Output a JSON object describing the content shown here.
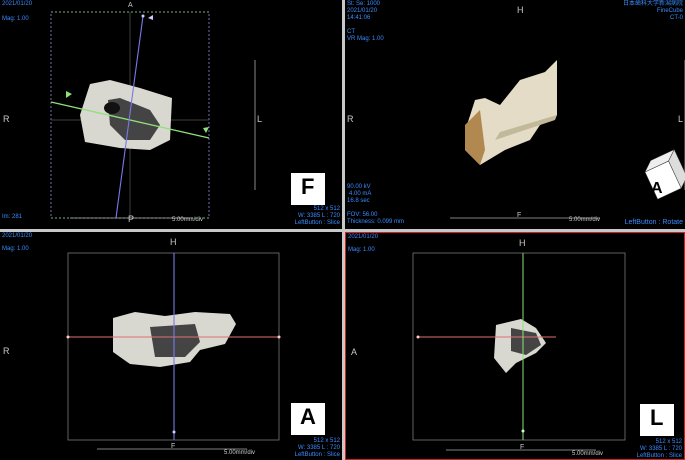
{
  "viewports": {
    "axial": {
      "date": "2021/01/20",
      "mag": "Mag: 1.00",
      "image_number": "Im: 281",
      "orient": {
        "top": "A",
        "left": "R",
        "right": "L",
        "bottom": "P"
      },
      "matrix": "512 x 512",
      "window": "W: 3385 L : 720",
      "mouse_mode": "LeftButton : Slice",
      "scale": "5.00mm/div",
      "orientation_marker": "F"
    },
    "volume": {
      "series": "St: Se: 1000",
      "date": "2021/01/20",
      "time": "14:41:06",
      "modality": "CT",
      "vr_mag": "VR Mag: 1.00",
      "institution": "日本歯科大学新潟病院",
      "device": "FineCube",
      "device_type": "CT-0",
      "kv": "90.00 kV",
      "ma": "4.00 mA",
      "sec": "16.8 sec",
      "fov": "FOV: 56.00",
      "thickness": "Thickness:  0.099 mm",
      "orient": {
        "top": "H",
        "left": "R",
        "right": "L",
        "bottom": "F"
      },
      "mouse_mode": "LeftButton : Rotate",
      "scale": "5.00mm/div",
      "orientation_marker": "A"
    },
    "coronal": {
      "date": "2021/01/20",
      "mag": "Mag: 1.00",
      "orient": {
        "top": "H",
        "left": "R",
        "bottom": "F"
      },
      "matrix": "512 x 512",
      "window": "W: 3385 L : 720",
      "mouse_mode": "LeftButton : Slice",
      "scale": "5.00mm/div",
      "orientation_marker": "A"
    },
    "sagittal": {
      "date": "2021/01/20",
      "mag": "Mag: 1.00",
      "orient": {
        "top": "H",
        "left": "A",
        "bottom": "F"
      },
      "matrix": "512 x 512",
      "window": "W: 3385 L : 720",
      "mouse_mode": "LeftButton : Slice",
      "scale": "5.00mm/div",
      "orientation_marker": "L"
    }
  },
  "colors": {
    "text": "#3a8cff",
    "axial_line": "#8fe07a",
    "coronal_line": "#7a78e8",
    "sagittal_line": "#e07070",
    "active_border": "#d02020"
  }
}
